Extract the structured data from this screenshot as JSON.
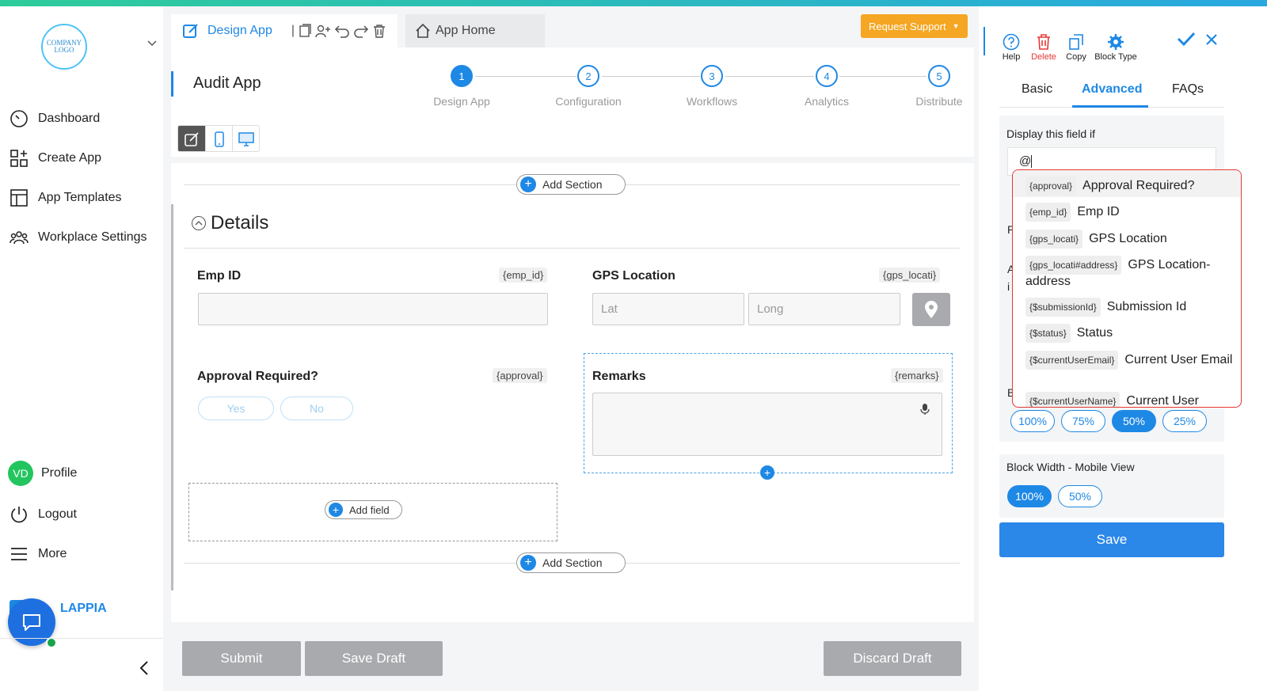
{
  "sidebar": {
    "logo_line1": "COMPANY",
    "logo_line2": "LOGO",
    "items": [
      {
        "label": "Dashboard"
      },
      {
        "label": "Create App"
      },
      {
        "label": "App Templates"
      },
      {
        "label": "Workplace Settings"
      }
    ],
    "profile_initials": "VD",
    "profile_label": "Profile",
    "logout_label": "Logout",
    "more_label": "More",
    "brand_name": "LAPPIA"
  },
  "tabs": {
    "design": "Design App",
    "home": "App Home"
  },
  "request_support": "Request Support",
  "app_title": "Audit App",
  "stepper": [
    {
      "num": "1",
      "label": "Design App"
    },
    {
      "num": "2",
      "label": "Configuration"
    },
    {
      "num": "3",
      "label": "Workflows"
    },
    {
      "num": "4",
      "label": "Analytics"
    },
    {
      "num": "5",
      "label": "Distribute"
    }
  ],
  "canvas": {
    "add_section": "Add Section",
    "section_title": "Details",
    "emp_id": {
      "label": "Emp ID",
      "key": "{emp_id}"
    },
    "gps": {
      "label": "GPS Location",
      "key": "{gps_locati}",
      "lat_placeholder": "Lat",
      "long_placeholder": "Long"
    },
    "approval": {
      "label": "Approval Required?",
      "key": "{approval}",
      "yes": "Yes",
      "no": "No"
    },
    "remarks": {
      "label": "Remarks",
      "key": "{remarks}"
    },
    "add_field": "Add field"
  },
  "footer": {
    "submit": "Submit",
    "save_draft": "Save Draft",
    "discard_draft": "Discard Draft"
  },
  "right_panel": {
    "tools": [
      {
        "label": "Help",
        "icon": "help-icon"
      },
      {
        "label": "Delete",
        "icon": "trash-icon"
      },
      {
        "label": "Copy",
        "icon": "copy-icon"
      },
      {
        "label": "Block Type",
        "icon": "gear-icon"
      }
    ],
    "tabs": [
      "Basic",
      "Advanced",
      "FAQs"
    ],
    "display_if_label": "Display this field if",
    "display_if_value": "@",
    "dropdown": [
      {
        "tag": "{approval}",
        "text": "Approval Required?"
      },
      {
        "tag": "{emp_id}",
        "text": "Emp ID"
      },
      {
        "tag": "{gps_locati}",
        "text": "GPS Location"
      },
      {
        "tag": "{gps_locati#address}",
        "text": "GPS Location-address"
      },
      {
        "tag": "{$submissionId}",
        "text": "Submission Id"
      },
      {
        "tag": "{$status}",
        "text": "Status"
      },
      {
        "tag": "{$currentUserEmail}",
        "text": "Current User Email"
      },
      {
        "tag": "{$currentUserName}",
        "text": "Current User"
      }
    ],
    "hidden_letters": [
      "P",
      "A",
      "i",
      "B"
    ],
    "desktop_widths": [
      "100%",
      "75%",
      "50%",
      "25%"
    ],
    "mobile_label": "Block Width - Mobile View",
    "mobile_widths": [
      "100%",
      "50%"
    ],
    "save": "Save"
  },
  "colors": {
    "accent": "#1e88e5",
    "support": "#f5a623",
    "danger": "#e53935"
  }
}
